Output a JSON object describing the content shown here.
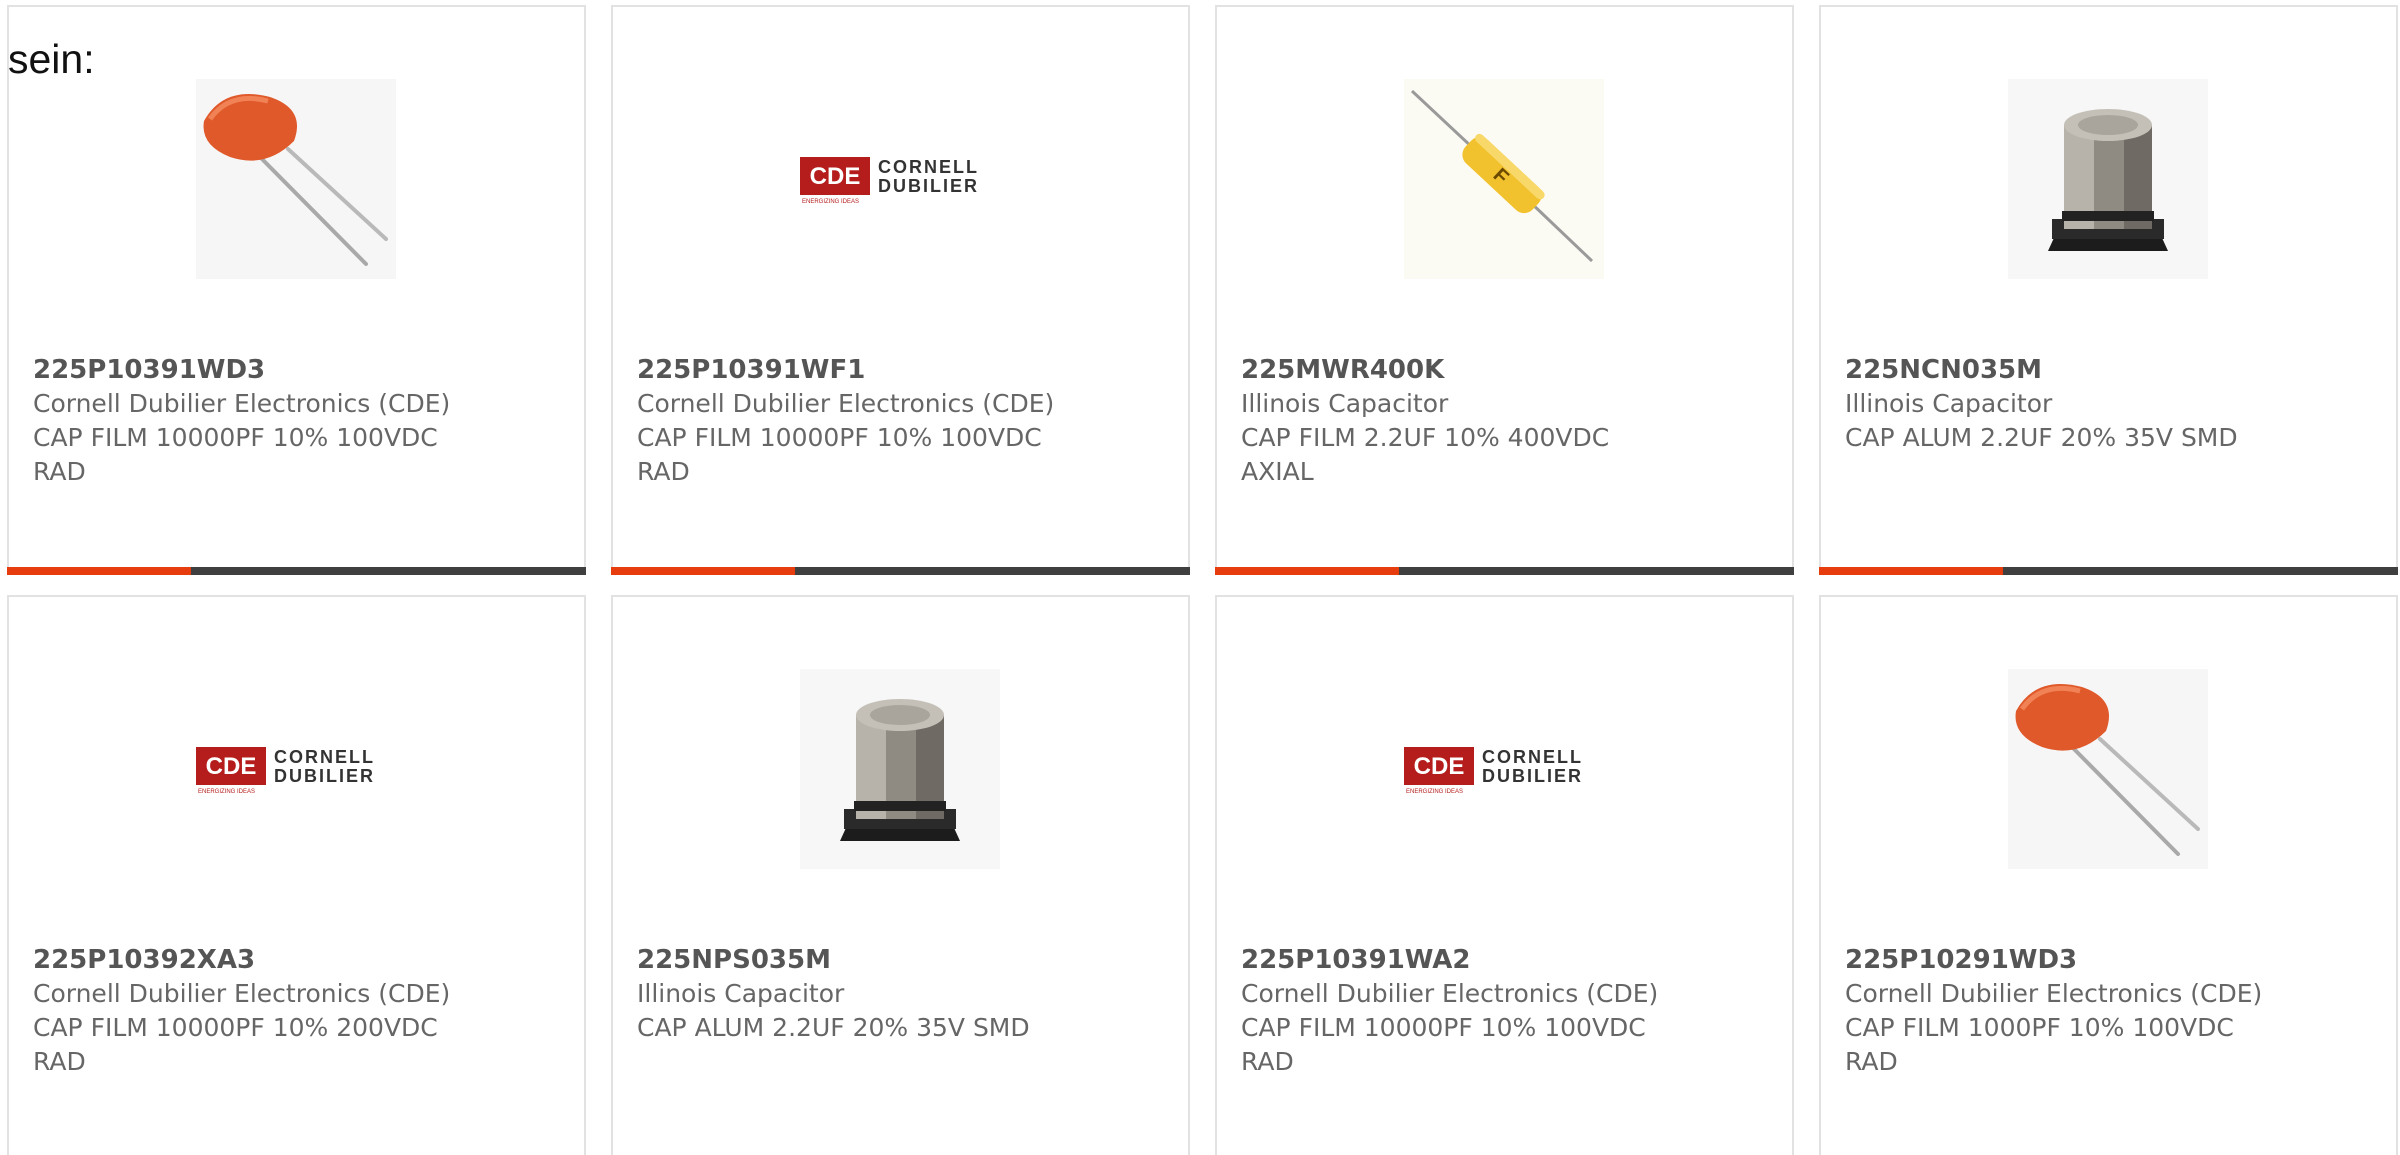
{
  "intro": {
    "text": "sein:"
  },
  "brand_logo": {
    "mark": "CDE",
    "line1": "CORNELL",
    "line2": "DUBILIER",
    "tagline": "ENERGIZING IDEAS",
    "accent": "#b51d1d"
  },
  "colors": {
    "accent_bar": "#e63c0e",
    "bar_dark": "#3f3f3f",
    "card_border": "#e2e2e2",
    "text": "#555555"
  },
  "products": [
    {
      "part_number": "225P10391WD3",
      "manufacturer": "Cornell Dubilier Electronics (CDE)",
      "description": "CAP FILM 10000PF 10% 100VDC RAD",
      "image": "orange-film-capacitor-icon"
    },
    {
      "part_number": "225P10391WF1",
      "manufacturer": "Cornell Dubilier Electronics (CDE)",
      "description": "CAP FILM 10000PF 10% 100VDC RAD",
      "image": "cde-logo"
    },
    {
      "part_number": "225MWR400K",
      "manufacturer": "Illinois Capacitor",
      "description": "CAP FILM 2.2UF 10% 400VDC AXIAL",
      "image": "axial-film-capacitor-icon"
    },
    {
      "part_number": "225NCN035M",
      "manufacturer": "Illinois Capacitor",
      "description": "CAP ALUM 2.2UF 20% 35V SMD",
      "image": "smd-aluminum-capacitor-icon"
    },
    {
      "part_number": "225P10392XA3",
      "manufacturer": "Cornell Dubilier Electronics (CDE)",
      "description": "CAP FILM 10000PF 10% 200VDC RAD",
      "image": "cde-logo"
    },
    {
      "part_number": "225NPS035M",
      "manufacturer": "Illinois Capacitor",
      "description": "CAP ALUM 2.2UF 20% 35V SMD",
      "image": "smd-aluminum-capacitor-icon"
    },
    {
      "part_number": "225P10391WA2",
      "manufacturer": "Cornell Dubilier Electronics (CDE)",
      "description": "CAP FILM 10000PF 10% 100VDC RAD",
      "image": "cde-logo"
    },
    {
      "part_number": "225P10291WD3",
      "manufacturer": "Cornell Dubilier Electronics (CDE)",
      "description": "CAP FILM 1000PF 10% 100VDC RAD",
      "image": "orange-film-capacitor-icon"
    }
  ]
}
